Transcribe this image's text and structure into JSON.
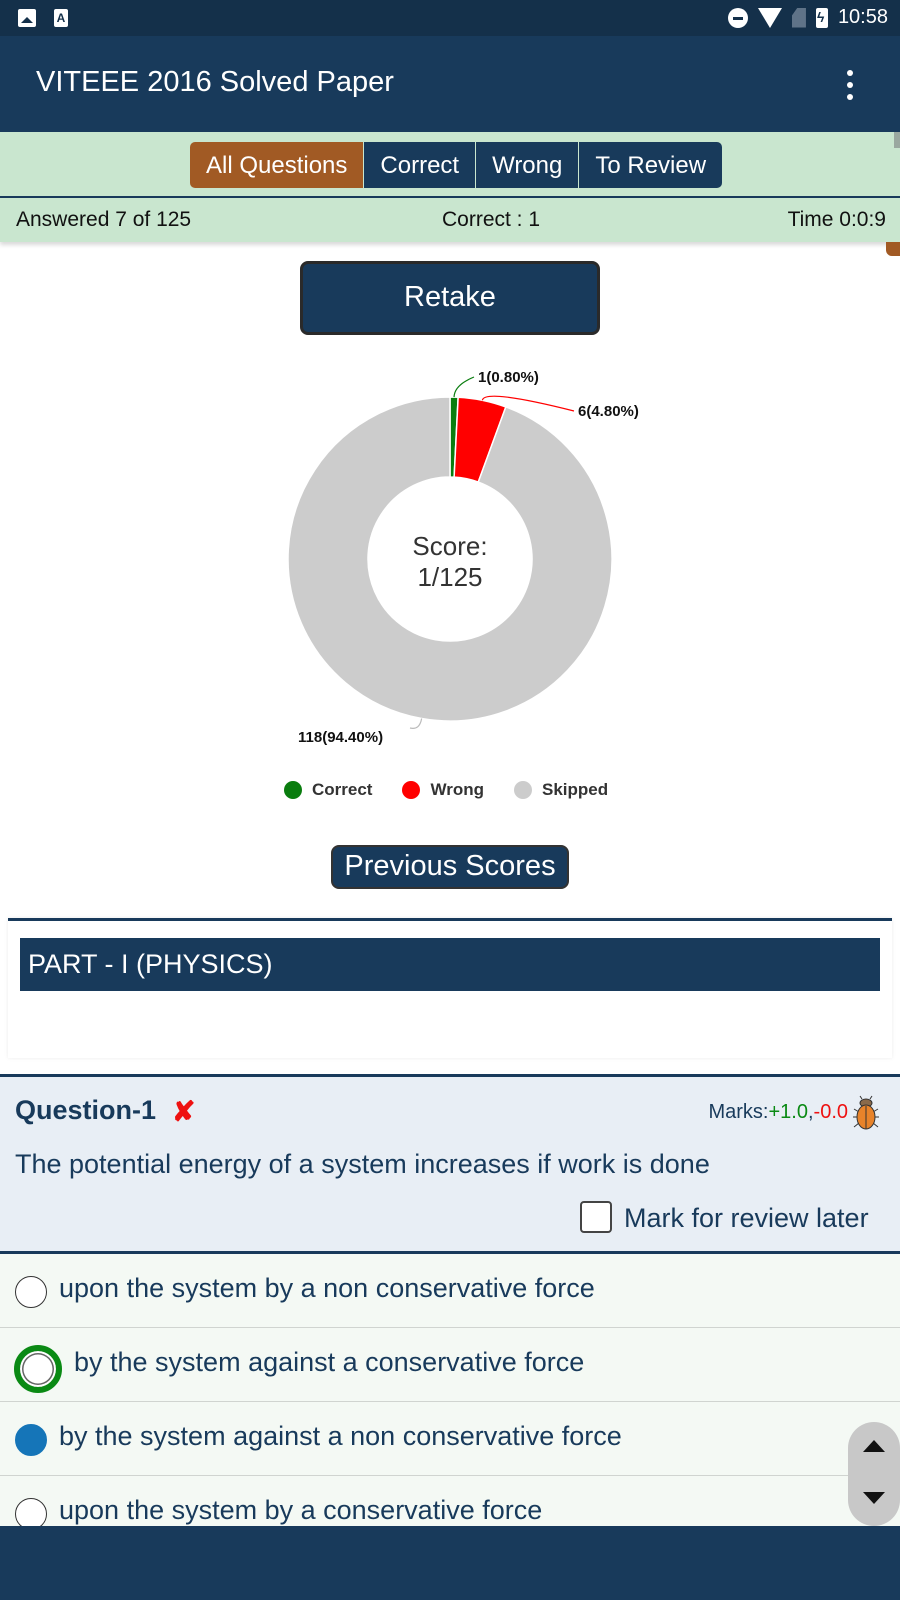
{
  "status_bar": {
    "time": "10:58",
    "left_icons": [
      "image-notification-icon",
      "font-notification-icon"
    ],
    "right_icons": [
      "do-not-disturb-icon",
      "wifi-icon",
      "no-sim-icon",
      "battery-charging-icon"
    ]
  },
  "app_bar": {
    "title": "VITEEE 2016 Solved Paper",
    "menu_icon": "more-vert-icon"
  },
  "filter_tabs": [
    {
      "label": "All Questions",
      "active": true
    },
    {
      "label": "Correct",
      "active": false
    },
    {
      "label": "Wrong",
      "active": false
    },
    {
      "label": "To Review",
      "active": false
    }
  ],
  "summary": {
    "answered": "Answered 7 of 125",
    "correct": "Correct : 1",
    "time": "Time 0:0:9"
  },
  "retake_label": "Retake",
  "chart_data": {
    "type": "pie",
    "donut": true,
    "center_text": [
      "Score:",
      "1/125"
    ],
    "slices": [
      {
        "name": "Correct",
        "value": 1,
        "percent": 0.8,
        "label": "1(0.80%)",
        "color": "#0a7d0f"
      },
      {
        "name": "Wrong",
        "value": 6,
        "percent": 4.8,
        "label": "6(4.80%)",
        "color": "#ff0000"
      },
      {
        "name": "Skipped",
        "value": 118,
        "percent": 94.4,
        "label": "118(94.40%)",
        "color": "#cccccc"
      }
    ],
    "legend": [
      "Correct",
      "Wrong",
      "Skipped"
    ],
    "legend_placement": "bottom"
  },
  "previous_scores_label": "Previous Scores",
  "section_title": "PART - I (PHYSICS)",
  "question": {
    "title": "Question-1",
    "status_icon": "wrong-cross-icon",
    "marks_prefix": "Marks:",
    "marks_plus": "+1.0",
    "marks_sep": ",",
    "marks_minus": "-0.0",
    "report_icon": "bug-icon",
    "text": "The potential energy of a system increases if work is done",
    "review_label": "Mark for review later",
    "review_checked": false,
    "options": [
      {
        "text": "upon the system by a non conservative force",
        "state": "none"
      },
      {
        "text": "by the system against a conservative force",
        "state": "correct"
      },
      {
        "text": "by the system against a non conservative force",
        "state": "selected"
      },
      {
        "text": "upon the system by a conservative force",
        "state": "none"
      }
    ]
  },
  "colors": {
    "primary": "#183a5b",
    "accent": "#a15a24",
    "filter_bg": "#c9e6cf",
    "correct": "#0a7d0f",
    "wrong": "#ff0000",
    "skipped": "#cccccc",
    "selected": "#1575b8"
  }
}
